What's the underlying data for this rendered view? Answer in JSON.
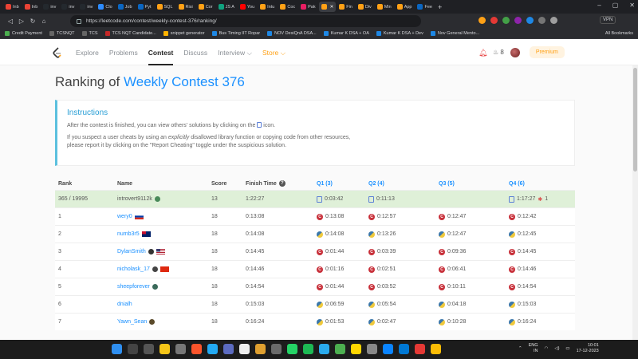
{
  "browser": {
    "tabs": [
      {
        "label": "Inb",
        "color": "#ea4335"
      },
      {
        "label": "Inb",
        "color": "#ea4335"
      },
      {
        "label": "inv",
        "color": "#24292e"
      },
      {
        "label": "inv",
        "color": "#24292e"
      },
      {
        "label": "inv",
        "color": "#24292e"
      },
      {
        "label": "Clo",
        "color": "#2d8cff"
      },
      {
        "label": "Job",
        "color": "#0a66c2"
      },
      {
        "label": "Pyt",
        "color": "#0a66c2"
      },
      {
        "label": "SQL",
        "color": "#ffa116"
      },
      {
        "label": "Risi",
        "color": "#ffa116"
      },
      {
        "label": "Cor",
        "color": "#ffa116"
      },
      {
        "label": "JS A",
        "color": "#10a37f"
      },
      {
        "label": "You",
        "color": "#ff0000"
      },
      {
        "label": "Intu",
        "color": "#ffa116"
      },
      {
        "label": "Coc",
        "color": "#ffa116"
      },
      {
        "label": "Pak",
        "color": "#e91e63"
      },
      {
        "label": "",
        "color": "#ffa116",
        "active": true
      },
      {
        "label": "Fin",
        "color": "#ffa116"
      },
      {
        "label": "Div",
        "color": "#ffa116"
      },
      {
        "label": "Min",
        "color": "#ffa116"
      },
      {
        "label": "App",
        "color": "#ffa116"
      },
      {
        "label": "Fee",
        "color": "#0a66c2"
      }
    ],
    "new_tab": "+",
    "url": "https://leetcode.com/contest/weekly-contest-376/ranking/",
    "vpn": "VPN",
    "bookmarks": [
      {
        "label": "Credit Payment",
        "color": "#4caf50"
      },
      {
        "label": "TCSNQT",
        "color": "#666"
      },
      {
        "label": "TCS",
        "color": "#666"
      },
      {
        "label": "TCS NQT Candidate...",
        "color": "#c62828"
      },
      {
        "label": "snippet generator",
        "color": "#ffb300"
      },
      {
        "label": "Bus Timing IIT Ropar",
        "color": "#1e88e5"
      },
      {
        "label": "NOV DesiQnA DSA...",
        "color": "#1e88e5"
      },
      {
        "label": "Kumar K DSA + OA",
        "color": "#1e88e5"
      },
      {
        "label": "Kumar K DSA + Dev",
        "color": "#1e88e5"
      },
      {
        "label": "Nov General Mento...",
        "color": "#1e88e5"
      }
    ],
    "all_bookmarks": "All Bookmarks"
  },
  "header": {
    "nav": [
      "Explore",
      "Problems",
      "Contest",
      "Discuss",
      "Interview ⌵",
      "Store ⌵"
    ],
    "streak": "8",
    "premium": "Premium"
  },
  "page": {
    "title_prefix": "Ranking of ",
    "title_link": "Weekly Contest 376",
    "instructions": {
      "heading": "Instructions",
      "line1_a": "After the contest is finished, you can view others' solutions by clicking on the",
      "line1_b": "icon.",
      "line2_a": "If you suspect a user cheats by using an ",
      "line2_em": "explicitly",
      "line2_b": " disallowed library function or copying code from other resources,",
      "line3": "please report it by clicking on the \"Report Cheating\" toggle under the suspicious solution."
    }
  },
  "table": {
    "headers": {
      "rank": "Rank",
      "name": "Name",
      "score": "Score",
      "finish": "Finish Time",
      "q1": "Q1 (3)",
      "q2": "Q2 (4)",
      "q3": "Q3 (5)",
      "q4": "Q4 (6)"
    },
    "rows": [
      {
        "rank": "365 / 19995",
        "name": "introvert9112k",
        "score": "13",
        "finish": "1:22:27",
        "q1": "0:03:42",
        "q2": "0:11:13",
        "q3": "",
        "q4": "1:17:27",
        "q4_bugs": "1",
        "mine": true
      },
      {
        "rank": "1",
        "name": "wery0",
        "score": "18",
        "finish": "0:13:08",
        "q1": "0:13:08",
        "q2": "0:12:57",
        "q3": "0:12:47",
        "q4": "0:12:42"
      },
      {
        "rank": "2",
        "name": "numb3r5",
        "score": "18",
        "finish": "0:14:08",
        "q1": "0:14:08",
        "q2": "0:13:26",
        "q3": "0:12:47",
        "q4": "0:12:45"
      },
      {
        "rank": "3",
        "name": "DylanSmith",
        "score": "18",
        "finish": "0:14:45",
        "q1": "0:01:44",
        "q2": "0:03:39",
        "q3": "0:09:36",
        "q4": "0:14:45"
      },
      {
        "rank": "4",
        "name": "nicholask_17",
        "score": "18",
        "finish": "0:14:46",
        "q1": "0:01:16",
        "q2": "0:02:51",
        "q3": "0:06:41",
        "q4": "0:14:46"
      },
      {
        "rank": "5",
        "name": "sheepforever",
        "score": "18",
        "finish": "0:14:54",
        "q1": "0:01:44",
        "q2": "0:03:52",
        "q3": "0:10:11",
        "q4": "0:14:54"
      },
      {
        "rank": "6",
        "name": "dnialh",
        "score": "18",
        "finish": "0:15:03",
        "q1": "0:06:59",
        "q2": "0:05:54",
        "q3": "0:04:18",
        "q4": "0:15:03"
      },
      {
        "rank": "7",
        "name": "Yawn_Sean",
        "score": "18",
        "finish": "0:16:24",
        "q1": "0:01:53",
        "q2": "0:02:47",
        "q3": "0:10:28",
        "q4": "0:16:24"
      }
    ]
  },
  "taskbar": {
    "lang": "ENG",
    "region": "IN",
    "time": "10:01",
    "date": "17-12-2023"
  }
}
